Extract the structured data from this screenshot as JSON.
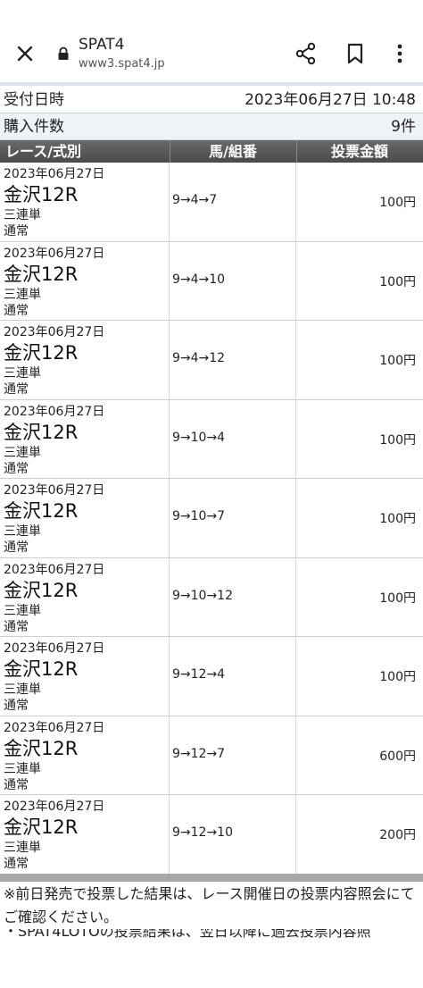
{
  "browser": {
    "title": "SPAT4",
    "url": "www3.spat4.jp",
    "icons": [
      "close-icon",
      "lock-icon",
      "share-icon",
      "bookmark-icon",
      "more-vert-icon"
    ]
  },
  "summary": {
    "received_label": "受付日時",
    "received_value": "2023年06月27日 10:48",
    "count_label": "購入件数",
    "count_value": "9件"
  },
  "table": {
    "headers": [
      "レース/式別",
      "馬/組番",
      "投票金額"
    ],
    "rows": [
      {
        "date": "2023年06月27日",
        "race": "金沢12R",
        "bet_type": "三連単",
        "method": "通常",
        "combo": "9→4→7",
        "amount": "100円"
      },
      {
        "date": "2023年06月27日",
        "race": "金沢12R",
        "bet_type": "三連単",
        "method": "通常",
        "combo": "9→4→10",
        "amount": "100円"
      },
      {
        "date": "2023年06月27日",
        "race": "金沢12R",
        "bet_type": "三連単",
        "method": "通常",
        "combo": "9→4→12",
        "amount": "100円"
      },
      {
        "date": "2023年06月27日",
        "race": "金沢12R",
        "bet_type": "三連単",
        "method": "通常",
        "combo": "9→10→4",
        "amount": "100円"
      },
      {
        "date": "2023年06月27日",
        "race": "金沢12R",
        "bet_type": "三連単",
        "method": "通常",
        "combo": "9→10→7",
        "amount": "100円"
      },
      {
        "date": "2023年06月27日",
        "race": "金沢12R",
        "bet_type": "三連単",
        "method": "通常",
        "combo": "9→10→12",
        "amount": "100円"
      },
      {
        "date": "2023年06月27日",
        "race": "金沢12R",
        "bet_type": "三連単",
        "method": "通常",
        "combo": "9→12→4",
        "amount": "100円"
      },
      {
        "date": "2023年06月27日",
        "race": "金沢12R",
        "bet_type": "三連単",
        "method": "通常",
        "combo": "9→12→7",
        "amount": "600円"
      },
      {
        "date": "2023年06月27日",
        "race": "金沢12R",
        "bet_type": "三連単",
        "method": "通常",
        "combo": "9→12→10",
        "amount": "200円"
      }
    ]
  },
  "notice": {
    "text1": "※前日発売で投票した結果は、レース開催日の投票内容照会にてご確認ください。",
    "text2": "・SPAT4LOTOの投票結果は、翌日以降に過去投票内容照"
  }
}
